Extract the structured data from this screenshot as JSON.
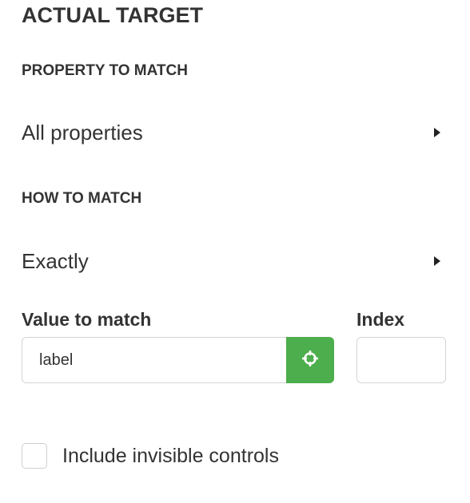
{
  "panel": {
    "title": "ACTUAL TARGET"
  },
  "property_to_match": {
    "label": "PROPERTY TO MATCH",
    "selected": "All properties"
  },
  "how_to_match": {
    "label": "HOW TO MATCH",
    "selected": "Exactly"
  },
  "value_to_match": {
    "label": "Value to match",
    "value": "label",
    "pick_button_icon": "crosshair-icon"
  },
  "index": {
    "label": "Index",
    "value": ""
  },
  "include_invisible": {
    "label": "Include invisible controls",
    "checked": false
  },
  "colors": {
    "accent_green": "#4cae4c",
    "text": "#333333",
    "border": "#d4d4d4"
  }
}
